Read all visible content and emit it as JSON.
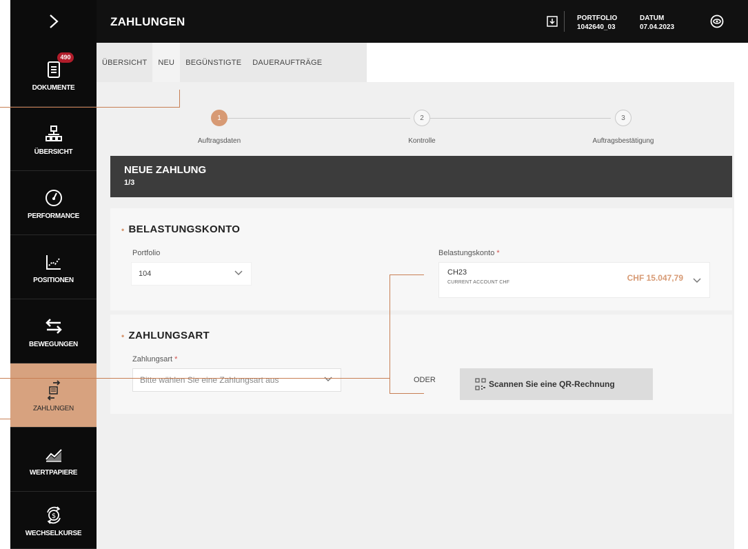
{
  "sidebar": {
    "items": [
      {
        "label": "DOKUMENTE",
        "badge": "490",
        "icon": "document-icon"
      },
      {
        "label": "ÜBERSICHT",
        "icon": "sitemap-icon"
      },
      {
        "label": "PERFORMANCE",
        "icon": "speedometer-icon"
      },
      {
        "label": "POSITIONEN",
        "icon": "chart-line-icon"
      },
      {
        "label": "BEWEGUNGEN",
        "icon": "transfer-arrows-icon"
      },
      {
        "label": "ZAHLUNGEN",
        "icon": "payment-transfer-icon",
        "active": true
      },
      {
        "label": "WERTPAPIERE",
        "icon": "chart-area-icon"
      },
      {
        "label": "WECHSELKURSE",
        "icon": "currency-exchange-icon"
      }
    ]
  },
  "header": {
    "title": "ZAHLUNGEN",
    "portfolio_label": "PORTFOLIO",
    "portfolio_value": "1042640_03",
    "date_label": "DATUM",
    "date_value": "07.04.2023"
  },
  "tabs": [
    "ÜBERSICHT",
    "NEU",
    "BEGÜNSTIGTE",
    "DAUERAUFTRÄGE"
  ],
  "active_tab": "NEU",
  "stepper": {
    "steps": [
      {
        "number": "1",
        "label": "Auftragsdaten",
        "active": true
      },
      {
        "number": "2",
        "label": "Kontrolle",
        "active": false
      },
      {
        "number": "3",
        "label": "Auftragsbestätigung",
        "active": false
      }
    ]
  },
  "form_header": {
    "title": "NEUE ZAHLUNG",
    "step": "1/3"
  },
  "belastungskonto": {
    "section_title": "BELASTUNGSKONTO",
    "portfolio_label": "Portfolio",
    "portfolio_value": "104",
    "account_label": "Belastungskonto",
    "required_mark": "*",
    "account_iban": "CH23",
    "account_name": "CURRENT ACCOUNT CHF",
    "account_balance": "CHF 15.047,79"
  },
  "zahlungsart": {
    "section_title": "ZAHLUNGSART",
    "label": "Zahlungsart",
    "required_mark": "*",
    "placeholder": "Bitte wählen Sie eine Zahlungsart aus",
    "or_text": "ODER",
    "qr_button_label": "Scannen Sie eine QR-Rechnung"
  },
  "colors": {
    "accent": "#d79a74",
    "sidebar_bg": "#0c0c0c",
    "active_sidebar": "#d7a27f",
    "header_bar": "#3c3c3c"
  }
}
